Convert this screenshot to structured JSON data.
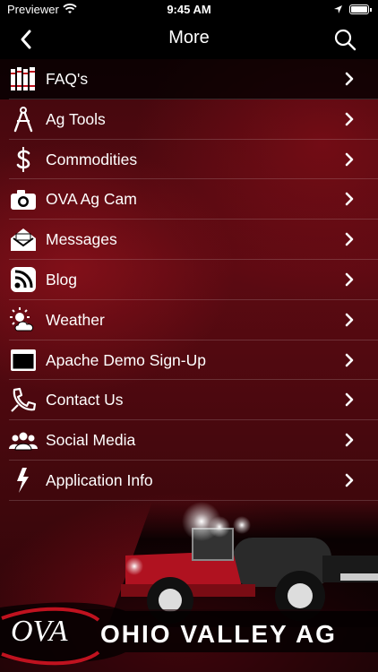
{
  "status_bar": {
    "carrier": "Previewer",
    "time": "9:45 AM",
    "battery_level": 1.0
  },
  "nav": {
    "title": "More",
    "back_icon": "chevron-left-icon",
    "search_icon": "search-icon"
  },
  "menu": [
    {
      "label": "FAQ's",
      "icon": "books-icon"
    },
    {
      "label": "Ag Tools",
      "icon": "compass-icon"
    },
    {
      "label": "Commodities",
      "icon": "dollar-icon"
    },
    {
      "label": "OVA Ag Cam",
      "icon": "camera-icon"
    },
    {
      "label": "Messages",
      "icon": "envelope-icon"
    },
    {
      "label": "Blog",
      "icon": "rss-icon"
    },
    {
      "label": "Weather",
      "icon": "weather-icon"
    },
    {
      "label": "Apache Demo Sign-Up",
      "icon": "window-icon"
    },
    {
      "label": "Contact Us",
      "icon": "phone-icon"
    },
    {
      "label": "Social Media",
      "icon": "people-icon"
    },
    {
      "label": "Application Info",
      "icon": "bolt-icon"
    }
  ],
  "banner": {
    "logo_text": "OVA",
    "brand_text": "OHIO VALLEY AG"
  },
  "colors": {
    "background": "#5c0a12",
    "bar": "#000000",
    "accent_red": "#c0121f"
  }
}
